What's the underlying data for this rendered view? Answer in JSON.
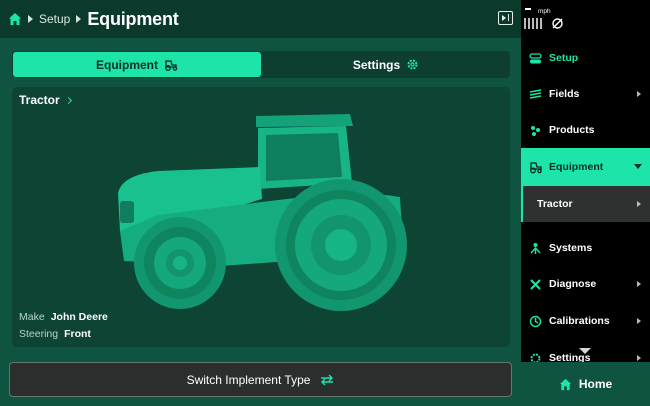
{
  "header": {
    "breadcrumb": "Setup",
    "title": "Equipment"
  },
  "tabs": [
    {
      "label": "Equipment",
      "icon": "tractor-icon",
      "active": true
    },
    {
      "label": "Settings",
      "icon": "gear-icon",
      "active": false
    }
  ],
  "card": {
    "title": "Tractor",
    "make_label": "Make",
    "make_value": "John Deere",
    "steering_label": "Steering",
    "steering_value": "Front"
  },
  "switch_button": {
    "label": "Switch Implement Type",
    "icon": "swap-arrows-icon"
  },
  "status": {
    "speed_unit": "mph"
  },
  "nav": {
    "items": [
      {
        "label": "Setup",
        "icon": "setup-icon"
      },
      {
        "label": "Fields",
        "icon": "fields-icon"
      },
      {
        "label": "Products",
        "icon": "products-icon"
      },
      {
        "label": "Equipment",
        "icon": "tractor-icon"
      },
      {
        "label": "Tractor",
        "icon": ""
      },
      {
        "label": "Systems",
        "icon": "systems-icon"
      },
      {
        "label": "Diagnose",
        "icon": "wrench-icon"
      },
      {
        "label": "Calibrations",
        "icon": "calibrations-icon"
      },
      {
        "label": "Settings",
        "icon": "gear-icon"
      }
    ],
    "home_label": "Home"
  },
  "colors": {
    "accent": "#1de5aa",
    "background": "#0f5440",
    "header": "#0b3a2c",
    "sidebar": "#000000"
  }
}
